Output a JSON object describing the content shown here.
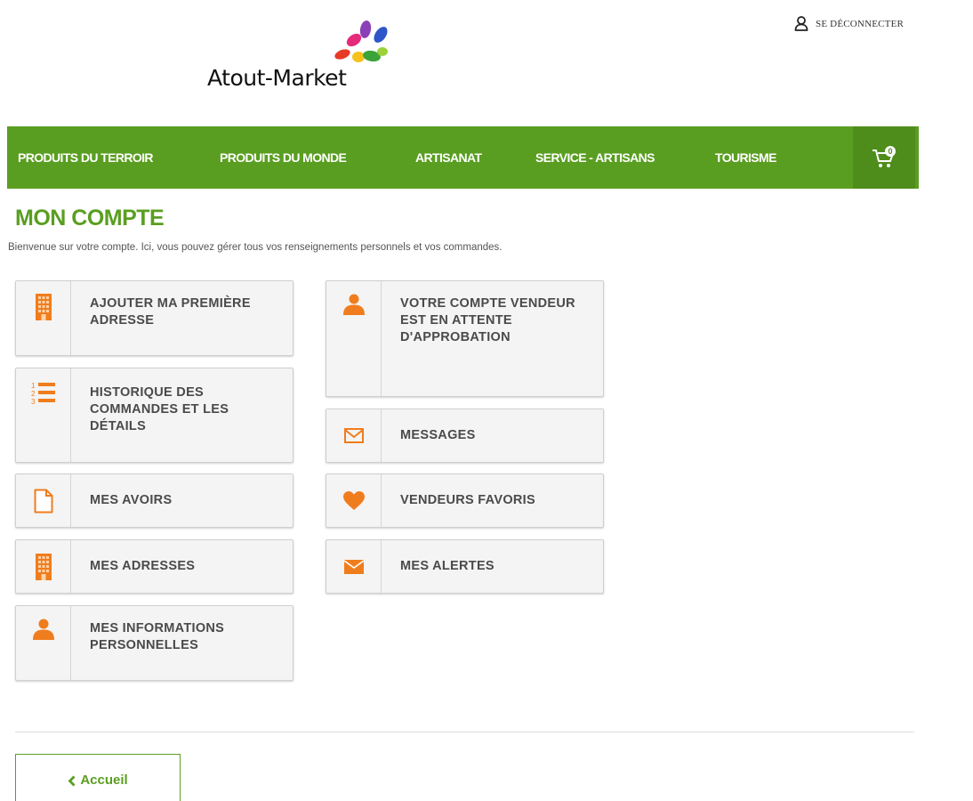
{
  "header": {
    "logo_text": "Atout-Market",
    "logout_label": "SE DÉCONNECTER"
  },
  "nav": {
    "items": [
      {
        "label": "PRODUITS DU TERROIR"
      },
      {
        "label": "PRODUITS DU MONDE"
      },
      {
        "label": "ARTISANAT"
      },
      {
        "label": "SERVICE - ARTISANS"
      },
      {
        "label": "TOURISME"
      }
    ],
    "cart_count": "0"
  },
  "page": {
    "title": "MON COMPTE",
    "subtitle": "Bienvenue sur votre compte. Ici, vous pouvez gérer tous vos renseignements personnels et vos commandes."
  },
  "tiles": [
    {
      "label": "AJOUTER MA PREMIÈRE ADRESSE",
      "icon": "building-icon"
    },
    {
      "label": "HISTORIQUE DES COMMANDES ET LES DÉTAILS",
      "icon": "ordered-list-icon"
    },
    {
      "label": "MES AVOIRS",
      "icon": "document-icon"
    },
    {
      "label": "MES ADRESSES",
      "icon": "building-icon"
    },
    {
      "label": "MES INFORMATIONS PERSONNELLES",
      "icon": "user-icon"
    },
    {
      "label": "VOTRE COMPTE VENDEUR EST EN ATTENTE D'APPROBATION",
      "icon": "user-icon"
    },
    {
      "label": "MESSAGES",
      "icon": "envelope-outline-icon"
    },
    {
      "label": "VENDEURS FAVORIS",
      "icon": "heart-icon"
    },
    {
      "label": "MES ALERTES",
      "icon": "envelope-icon"
    }
  ],
  "footer": {
    "back_label": "Accueil"
  },
  "colors": {
    "brand_green": "#5a9e21",
    "icon_orange": "#f07d1d"
  }
}
